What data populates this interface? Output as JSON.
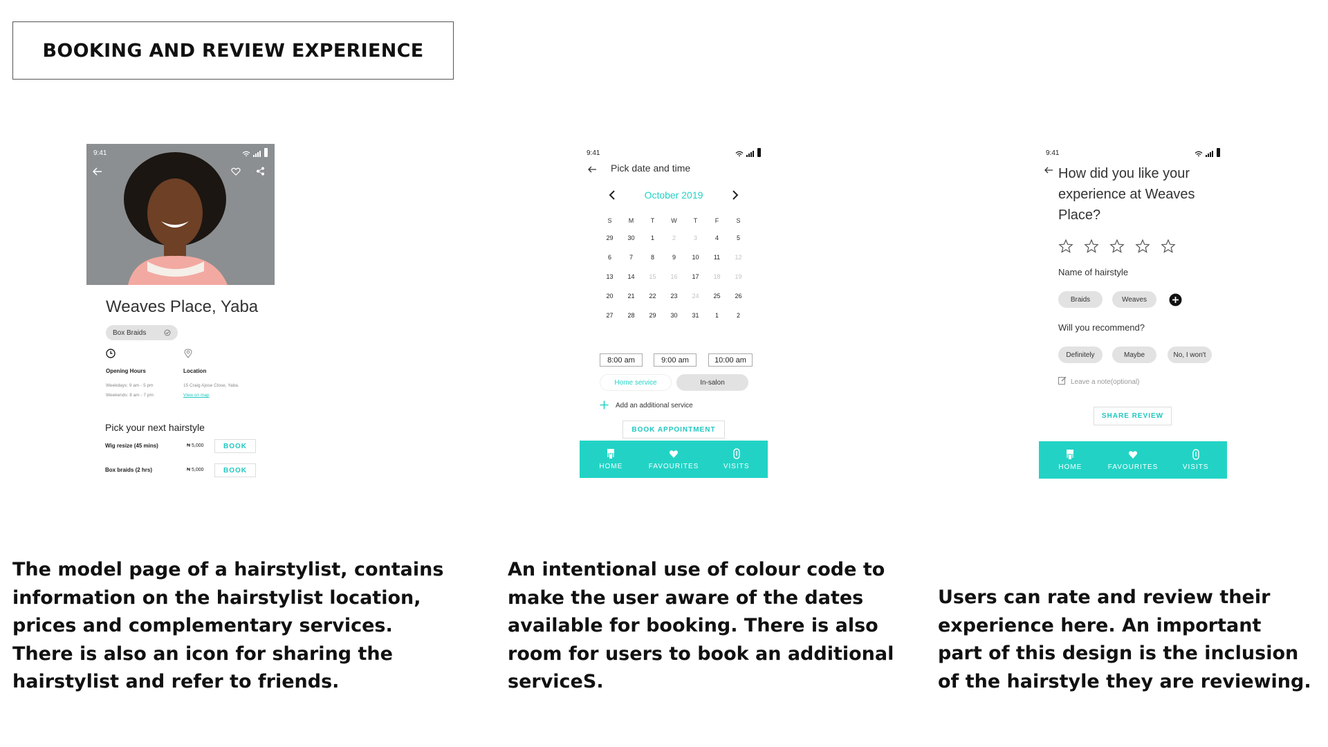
{
  "header": {
    "title": "BOOKING AND REVIEW EXPERIENCE"
  },
  "status_time": "9:41",
  "screen1": {
    "shop_name": "Weaves Place, Yaba",
    "tag": "Box Braids",
    "hours_label": "Opening Hours",
    "weekdays": "Weekdays: 9 am - 5 pm",
    "weekends": "Weekends: 8 am - 7 pm",
    "location_label": "Location",
    "address": "15 Craig Ajose Close, Yaba.",
    "view_map": "View on map",
    "pick_title": "Pick your next hairstyle",
    "services": [
      {
        "name": "Wig resize (45 mins)",
        "price": "₦ 5,000",
        "action": "BOOK"
      },
      {
        "name": "Box braids (2 hrs)",
        "price": "₦ 5,000",
        "action": "BOOK"
      }
    ]
  },
  "screen2": {
    "title": "Pick date and time",
    "month": "October 2019",
    "weekdays": [
      "S",
      "M",
      "T",
      "W",
      "T",
      "F",
      "S"
    ],
    "weeks": [
      [
        {
          "d": "29",
          "dim": false
        },
        {
          "d": "30",
          "dim": false
        },
        {
          "d": "1",
          "dim": false
        },
        {
          "d": "2",
          "dim": true
        },
        {
          "d": "3",
          "dim": true
        },
        {
          "d": "4",
          "dim": false
        },
        {
          "d": "5",
          "dim": false
        }
      ],
      [
        {
          "d": "6",
          "dim": false
        },
        {
          "d": "7",
          "dim": false
        },
        {
          "d": "8",
          "dim": false
        },
        {
          "d": "9",
          "dim": false
        },
        {
          "d": "10",
          "dim": false
        },
        {
          "d": "11",
          "dim": false
        },
        {
          "d": "12",
          "dim": true
        }
      ],
      [
        {
          "d": "13",
          "dim": false
        },
        {
          "d": "14",
          "dim": false
        },
        {
          "d": "15",
          "dim": true
        },
        {
          "d": "16",
          "dim": true
        },
        {
          "d": "17",
          "dim": false
        },
        {
          "d": "18",
          "dim": true
        },
        {
          "d": "19",
          "dim": true
        }
      ],
      [
        {
          "d": "20",
          "dim": false
        },
        {
          "d": "21",
          "dim": false
        },
        {
          "d": "22",
          "dim": false
        },
        {
          "d": "23",
          "dim": false
        },
        {
          "d": "24",
          "dim": true
        },
        {
          "d": "25",
          "dim": false
        },
        {
          "d": "26",
          "dim": false
        }
      ],
      [
        {
          "d": "27",
          "dim": false
        },
        {
          "d": "28",
          "dim": false
        },
        {
          "d": "29",
          "dim": false
        },
        {
          "d": "30",
          "dim": false
        },
        {
          "d": "31",
          "dim": false
        },
        {
          "d": "1",
          "dim": false
        },
        {
          "d": "2",
          "dim": false
        }
      ]
    ],
    "times": [
      "8:00 am",
      "9:00 am",
      "10:00 am"
    ],
    "home_service": "Home service",
    "in_salon": "In-salon",
    "add_service": "Add an additional service",
    "book_button": "BOOK APPOINTMENT"
  },
  "screen3": {
    "question": "How did you like your experience at Weaves Place?",
    "rating": 0,
    "rating_max": 5,
    "hairstyle_label": "Name of hairstyle",
    "hairstyles": [
      "Braids",
      "Weaves"
    ],
    "recommend_label": "Will you recommend?",
    "recommend_options": [
      "Definitely",
      "Maybe",
      "No, I won't"
    ],
    "note_placeholder": "Leave a note(optional)",
    "share_button": "SHARE REVIEW"
  },
  "nav": {
    "home": "HOME",
    "favourites": "FAVOURITES",
    "visits": "VISITS"
  },
  "captions": {
    "left": "The model page of a hairstylist, contains information on the hairstylist location, prices and complementary services. There is also an icon for sharing the hairstylist and refer to friends.",
    "middle": "An intentional use of colour code to make the user aware of the dates available for booking. There is also room for users to book an additional serviceS.",
    "right": "Users can rate and review their experience here. An important part of this design is the inclusion of the hairstyle they are reviewing."
  },
  "colors": {
    "accent": "#22d3c5",
    "chip": "#e2e2e2"
  }
}
